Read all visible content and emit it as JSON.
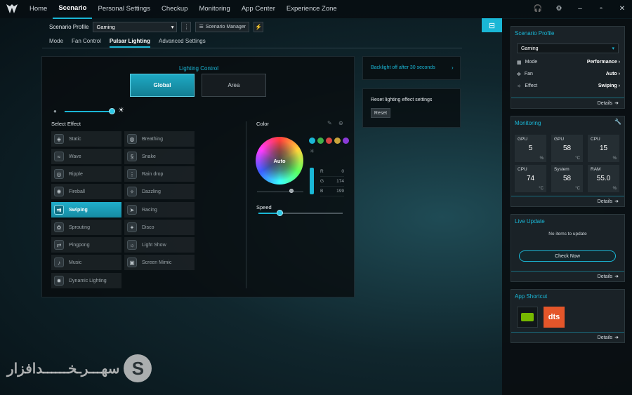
{
  "nav": {
    "items": [
      "Home",
      "Scenario",
      "Personal Settings",
      "Checkup",
      "Monitoring",
      "App Center",
      "Experience Zone"
    ],
    "active": "Scenario"
  },
  "profile": {
    "label": "Scenario Profile",
    "value": "Gaming",
    "manager_label": "Scenario Manager"
  },
  "subtabs": [
    "Mode",
    "Fan Control",
    "Pulsar Lighting",
    "Advanced Settings"
  ],
  "lighting": {
    "title": "Lighting Control",
    "global_label": "Global",
    "area_label": "Area",
    "select_effect_label": "Select Effect",
    "effects_left": [
      "Static",
      "Wave",
      "Ripple",
      "Fireball",
      "Swiping",
      "Sprouting",
      "Pingpong",
      "Music",
      "Dynamic Lighting"
    ],
    "effects_right": [
      "Breathing",
      "Snake",
      "Rain drop",
      "Dazzling",
      "Racing",
      "Disco",
      "Light Show",
      "Screen Mimic"
    ],
    "selected_effect": "Swiping",
    "brightness": 0.92
  },
  "color": {
    "title": "Color",
    "wheel_label": "Auto",
    "swatches": [
      "#1ab7d6",
      "#3fb04a",
      "#d84545",
      "#c9a43b",
      "#8a3ad8"
    ],
    "r_label": "R",
    "r": "0",
    "g_label": "G",
    "g": "174",
    "b_label": "B",
    "b": "199",
    "speed_label": "Speed",
    "speed": 0.25
  },
  "side": {
    "backlight_text": "Backlight off after 30 seconds",
    "reset_text": "Reset lighting effect settings",
    "reset_button": "Reset"
  },
  "right": {
    "scenario": {
      "title": "Scenario Profile",
      "value": "Gaming",
      "rows": [
        {
          "k": "Mode",
          "v": "Performance"
        },
        {
          "k": "Fan",
          "v": "Auto"
        },
        {
          "k": "Effect",
          "v": "Swiping"
        }
      ],
      "details": "Details"
    },
    "monitoring": {
      "title": "Monitoring",
      "details": "Details",
      "tiles": [
        {
          "label": "GPU",
          "value": "5",
          "unit": "%"
        },
        {
          "label": "GPU",
          "value": "58",
          "unit": "°C"
        },
        {
          "label": "CPU",
          "value": "15",
          "unit": "%"
        },
        {
          "label": "CPU",
          "value": "74",
          "unit": "°C"
        },
        {
          "label": "System",
          "value": "58",
          "unit": "°C"
        },
        {
          "label": "RAM",
          "value": "55.0",
          "unit": "%"
        }
      ]
    },
    "live_update": {
      "title": "Live Update",
      "empty": "No items to update",
      "button": "Check Now",
      "details": "Details"
    },
    "shortcut": {
      "title": "App Shortcut",
      "details": "Details",
      "dts": "dts"
    }
  },
  "watermark": {
    "text": "سهـــرـخــــــدافزار",
    "letter": "S"
  }
}
